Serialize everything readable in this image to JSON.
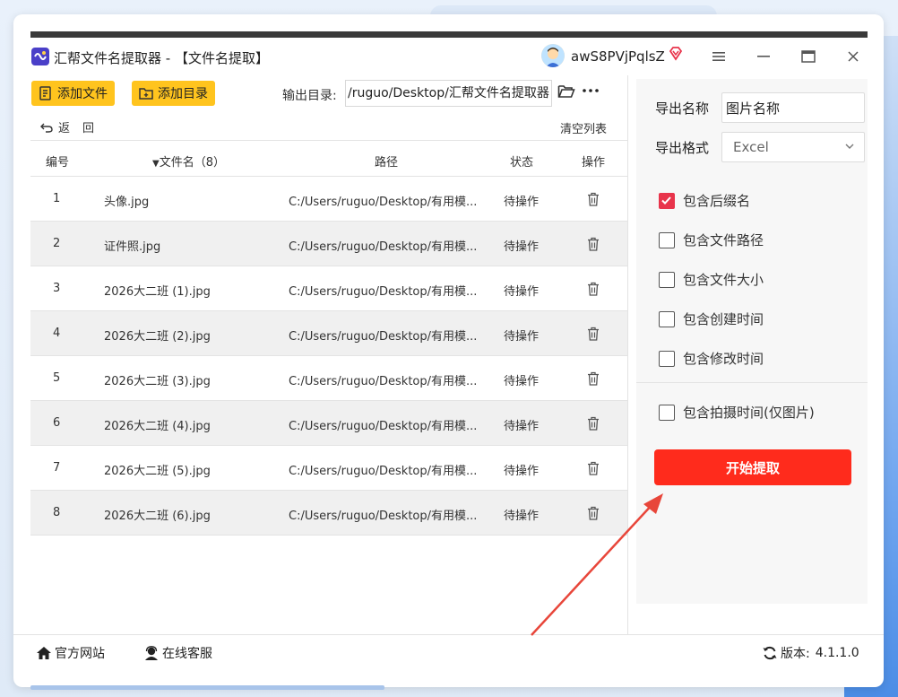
{
  "window": {
    "title": "汇帮文件名提取器 - 【文件名提取】",
    "username": "awS8PVjPqlsZ"
  },
  "toolbar": {
    "add_file": "添加文件",
    "add_dir": "添加目录",
    "output_label": "输出目录:",
    "output_path": "/ruguo/Desktop/汇帮文件名提取器",
    "back": "返回",
    "clear": "清空列表"
  },
  "table": {
    "headers": {
      "index": "编号",
      "filename": "文件名（8）",
      "path": "路径",
      "status": "状态",
      "action": "操作"
    },
    "rows": [
      {
        "index": "1",
        "name": "头像.jpg",
        "path": "C:/Users/ruguo/Desktop/有用模...",
        "status": "待操作"
      },
      {
        "index": "2",
        "name": "证件照.jpg",
        "path": "C:/Users/ruguo/Desktop/有用模...",
        "status": "待操作"
      },
      {
        "index": "3",
        "name": "2026大二班 (1).jpg",
        "path": "C:/Users/ruguo/Desktop/有用模...",
        "status": "待操作"
      },
      {
        "index": "4",
        "name": "2026大二班 (2).jpg",
        "path": "C:/Users/ruguo/Desktop/有用模...",
        "status": "待操作"
      },
      {
        "index": "5",
        "name": "2026大二班 (3).jpg",
        "path": "C:/Users/ruguo/Desktop/有用模...",
        "status": "待操作"
      },
      {
        "index": "6",
        "name": "2026大二班 (4).jpg",
        "path": "C:/Users/ruguo/Desktop/有用模...",
        "status": "待操作"
      },
      {
        "index": "7",
        "name": "2026大二班 (5).jpg",
        "path": "C:/Users/ruguo/Desktop/有用模...",
        "status": "待操作"
      },
      {
        "index": "8",
        "name": "2026大二班 (6).jpg",
        "path": "C:/Users/ruguo/Desktop/有用模...",
        "status": "待操作"
      }
    ]
  },
  "panel": {
    "export_name_label": "导出名称",
    "export_name_value": "图片名称",
    "export_format_label": "导出格式",
    "export_format_value": "Excel",
    "options": [
      {
        "label": "包含后缀名",
        "checked": true
      },
      {
        "label": "包含文件路径",
        "checked": false
      },
      {
        "label": "包含文件大小",
        "checked": false
      },
      {
        "label": "包含创建时间",
        "checked": false
      },
      {
        "label": "包含修改时间",
        "checked": false
      },
      {
        "label": "包含拍摄时间(仅图片)",
        "checked": false
      }
    ],
    "start": "开始提取"
  },
  "footer": {
    "website": "官方网站",
    "support": "在线客服",
    "version_label": "版本:",
    "version": "4.1.1.0"
  },
  "colors": {
    "accent_yellow": "#ffc41e",
    "start_red": "#ff2b1c",
    "check_red": "#e8344b",
    "arrow_red": "#e8463a"
  }
}
